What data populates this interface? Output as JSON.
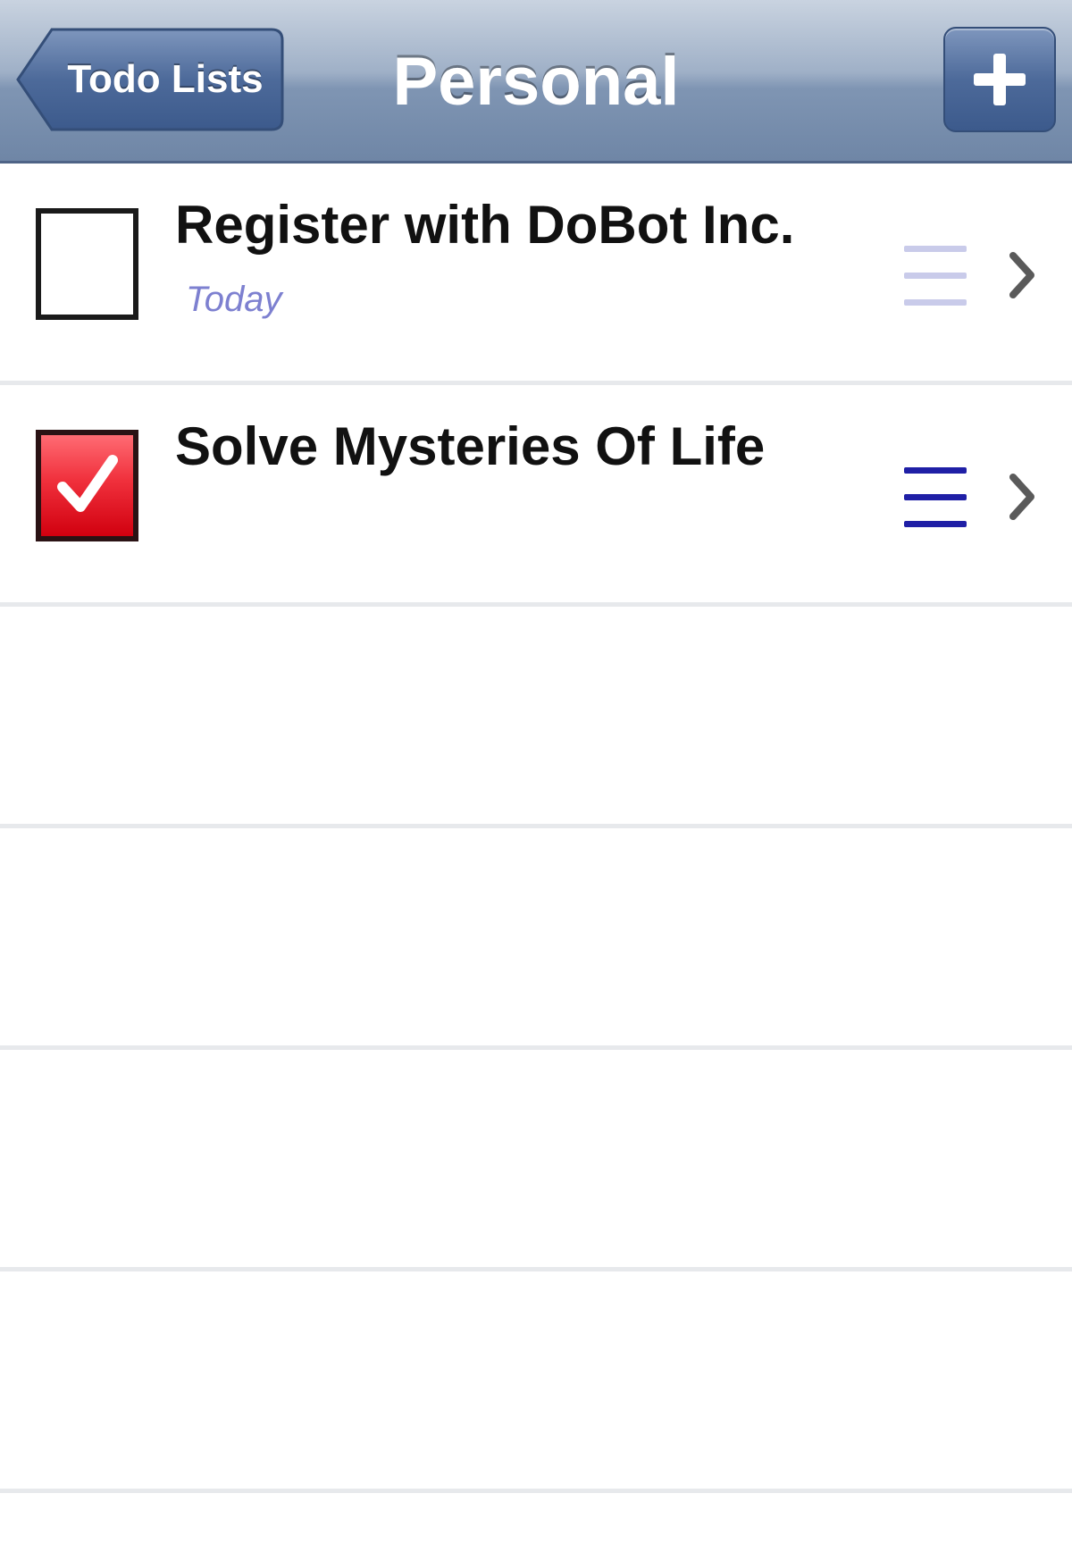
{
  "navbar": {
    "back_label": "Todo Lists",
    "title": "Personal",
    "add_icon": "plus-icon"
  },
  "items": [
    {
      "title": "Register with DoBot Inc.",
      "date": "Today",
      "checked": false,
      "priority_color": "#c9cbea"
    },
    {
      "title": "Solve Mysteries Of Life",
      "date": "",
      "checked": true,
      "priority_color": "#1f1fa6"
    }
  ],
  "empty_rows": 4,
  "colors": {
    "navbar_top": "#c9d3e0",
    "navbar_bottom": "#6f86a6",
    "checked_red": "#e01a28",
    "date_text": "#7d80d0",
    "separator": "#e7e9ec"
  }
}
